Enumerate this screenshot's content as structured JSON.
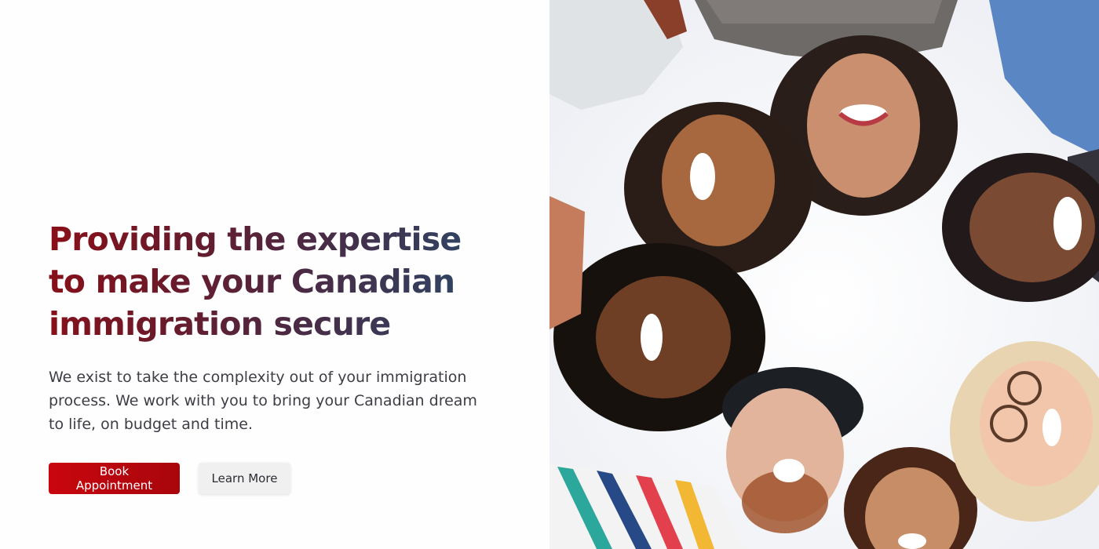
{
  "hero": {
    "title": "Providing the expertise to make your Canadian immigration secure",
    "description": "We exist to take the complexity out of your immigration process. We work with you to bring your Canadian dream to life, on budget and time.",
    "primary_button": "Book Appointment",
    "secondary_button": "Learn More"
  },
  "colors": {
    "primary": "#c9060f",
    "title_gradient_start": "#8a0f18",
    "title_gradient_end": "#2c4766",
    "secondary_button_bg": "#f0f0f1"
  }
}
